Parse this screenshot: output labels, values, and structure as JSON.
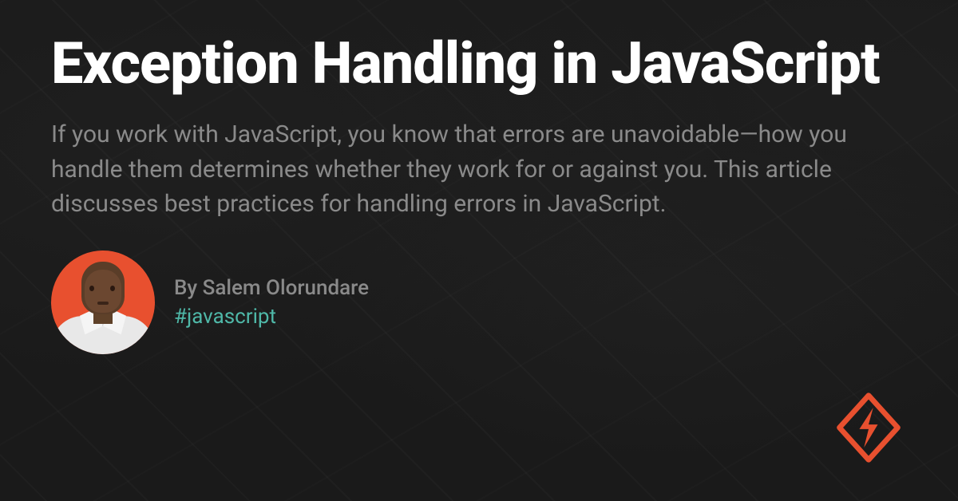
{
  "title": "Exception Handling in JavaScript",
  "description": "If you work with JavaScript, you know that errors are unavoidable—how you handle them determines whether they work for or against you. This article discusses best practices for handling errors in JavaScript.",
  "author": {
    "byline": "By Salem Olorundare",
    "hashtag": "#javascript"
  },
  "colors": {
    "accent": "#e8502f",
    "hashtag": "#4fb8a8",
    "background": "#1a1a1a"
  }
}
